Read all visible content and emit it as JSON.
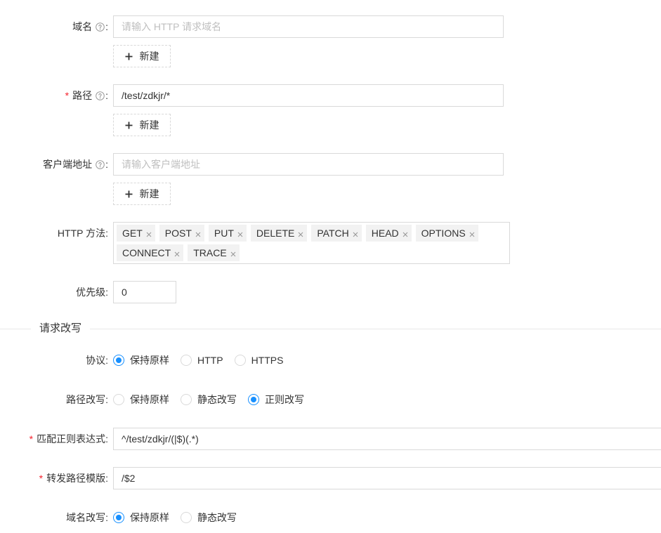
{
  "colors": {
    "accent": "#1890ff",
    "required": "#f5222d",
    "text": "#333333",
    "placeholder": "#bfbfbf",
    "border": "#d9d9d9"
  },
  "icons": {
    "help": "question-circle-icon",
    "add": "plus-icon",
    "remove": "close-icon"
  },
  "form": {
    "label_colon": ":",
    "required_mark": "*"
  },
  "match": {
    "domain": {
      "label": "域名",
      "placeholder": "请输入 HTTP 请求域名",
      "add_label": "新建"
    },
    "path": {
      "label": "路径",
      "required": true,
      "value": "/test/zdkjr/*",
      "add_label": "新建"
    },
    "client_address": {
      "label": "客户端地址",
      "placeholder": "请输入客户端地址",
      "add_label": "新建"
    },
    "http_methods": {
      "label": "HTTP 方法",
      "tags": [
        "GET",
        "POST",
        "PUT",
        "DELETE",
        "PATCH",
        "HEAD",
        "OPTIONS",
        "CONNECT",
        "TRACE"
      ]
    },
    "priority": {
      "label": "优先级",
      "value": "0"
    }
  },
  "rewrite": {
    "section_title": "请求改写",
    "protocol": {
      "label": "协议",
      "options": [
        "保持原样",
        "HTTP",
        "HTTPS"
      ],
      "selected": "保持原样"
    },
    "path_rewrite": {
      "label": "路径改写",
      "options": [
        "保持原样",
        "静态改写",
        "正则改写"
      ],
      "selected": "正则改写"
    },
    "match_regex": {
      "label": "匹配正则表达式",
      "required": true,
      "value": "^/test/zdkjr/(|$)(.*)"
    },
    "forward_path_template": {
      "label": "转发路径模版",
      "required": true,
      "value": "/$2"
    },
    "host_rewrite": {
      "label": "域名改写",
      "options": [
        "保持原样",
        "静态改写"
      ],
      "selected": "保持原样"
    }
  }
}
